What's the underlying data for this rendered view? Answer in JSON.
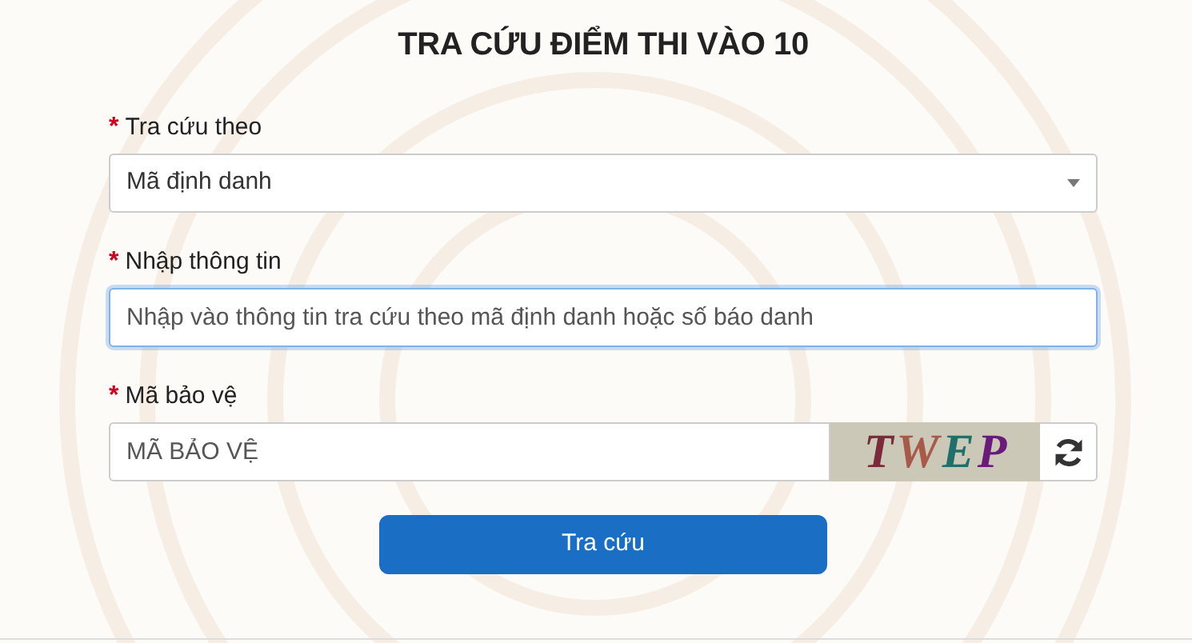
{
  "title": "TRA CỨU ĐIỂM THI VÀO 10",
  "fields": [
    {
      "kind": "select",
      "label": "Tra cứu theo",
      "required": true,
      "value": "Mã định danh",
      "focused": false
    },
    {
      "kind": "text",
      "label": "Nhập thông tin",
      "required": true,
      "placeholder": "Nhập vào thông tin tra cứu theo mã định danh hoặc số báo danh",
      "focused": true
    },
    {
      "kind": "captcha",
      "label": "Mã bảo vệ",
      "required": true,
      "placeholder": "MÃ BẢO VỆ",
      "focused": false,
      "captcha": [
        {
          "char": "T",
          "color": "#7a2a3a"
        },
        {
          "char": "W",
          "color": "#a85a4a"
        },
        {
          "char": "E",
          "color": "#1f6f6a"
        },
        {
          "char": "P",
          "color": "#6a1a7a"
        }
      ]
    }
  ],
  "required_mark": "*",
  "submit": "Tra cứu"
}
